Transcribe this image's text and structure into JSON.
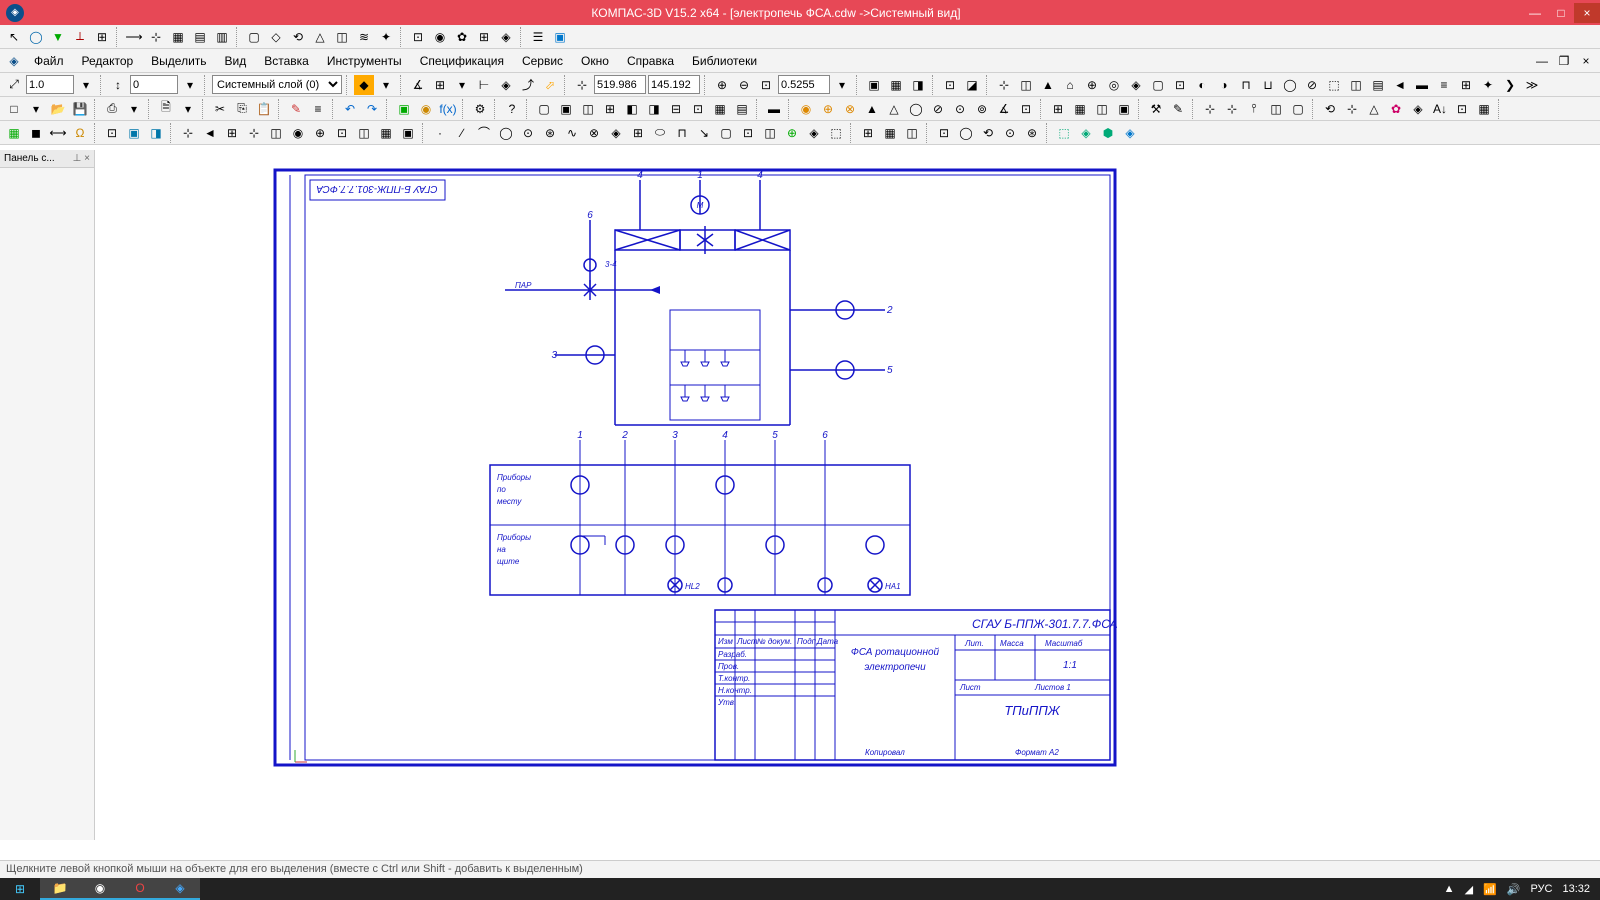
{
  "title": "КОМПАС-3D V15.2  x64 - [электропечь ФСА.cdw ->Системный вид]",
  "menus": [
    "Файл",
    "Редактор",
    "Выделить",
    "Вид",
    "Вставка",
    "Инструменты",
    "Спецификация",
    "Сервис",
    "Окно",
    "Справка",
    "Библиотеки"
  ],
  "toolbar": {
    "step": "1.0",
    "offset": "0",
    "layer": "Системный слой (0)",
    "coord_x": "519.986",
    "coord_y": "145.192",
    "zoom": "0.5255"
  },
  "panel": {
    "title": "Панель с...",
    "pin": "⊥",
    "close": "×"
  },
  "status": "Щелкните левой кнопкой мыши на объекте для его выделения (вместе с Ctrl или Shift - добавить к выделенным)",
  "tray": {
    "lang": "РУС",
    "time": "13:32"
  },
  "titleblock": {
    "code": "СГАУ Б-ППЖ-301.7.7.ФСА",
    "name1": "ФСА ротационной",
    "name2": "электропечи",
    "dept": "ТПиППЖ",
    "scale": "1:1",
    "format": "Формат    А2",
    "copy": "Копировал",
    "h_izm": "Изм",
    "h_lit": "Лист",
    "h_doc": "№ докум.",
    "h_pod": "Подп.",
    "h_dat": "Дата",
    "r1": "Разраб.",
    "r2": "Пров.",
    "r3": "Т.контр.",
    "r4": "Н.контр.",
    "r5": "Утв.",
    "lit": "Лит.",
    "massa": "Масса",
    "mashtab": "Масштаб",
    "list": "Лист",
    "listov": "Листов   1"
  },
  "schematic": {
    "rows": {
      "r1a": "Приборы",
      "r1b": "по",
      "r1c": "месту",
      "r2a": "Приборы",
      "r2b": "на",
      "r2c": "щите"
    },
    "cols": [
      "1",
      "2",
      "3",
      "4",
      "5",
      "6"
    ],
    "top_labels": {
      "l4": "4",
      "l1": "1",
      "l4b": "4",
      "l6": "6",
      "l34": "3-4",
      "lpar": "ПАР",
      "l3": "3",
      "l2": "2",
      "l5": "5"
    },
    "bot_labels": {
      "hl2": "HL2",
      "ha1": "HA1"
    }
  }
}
